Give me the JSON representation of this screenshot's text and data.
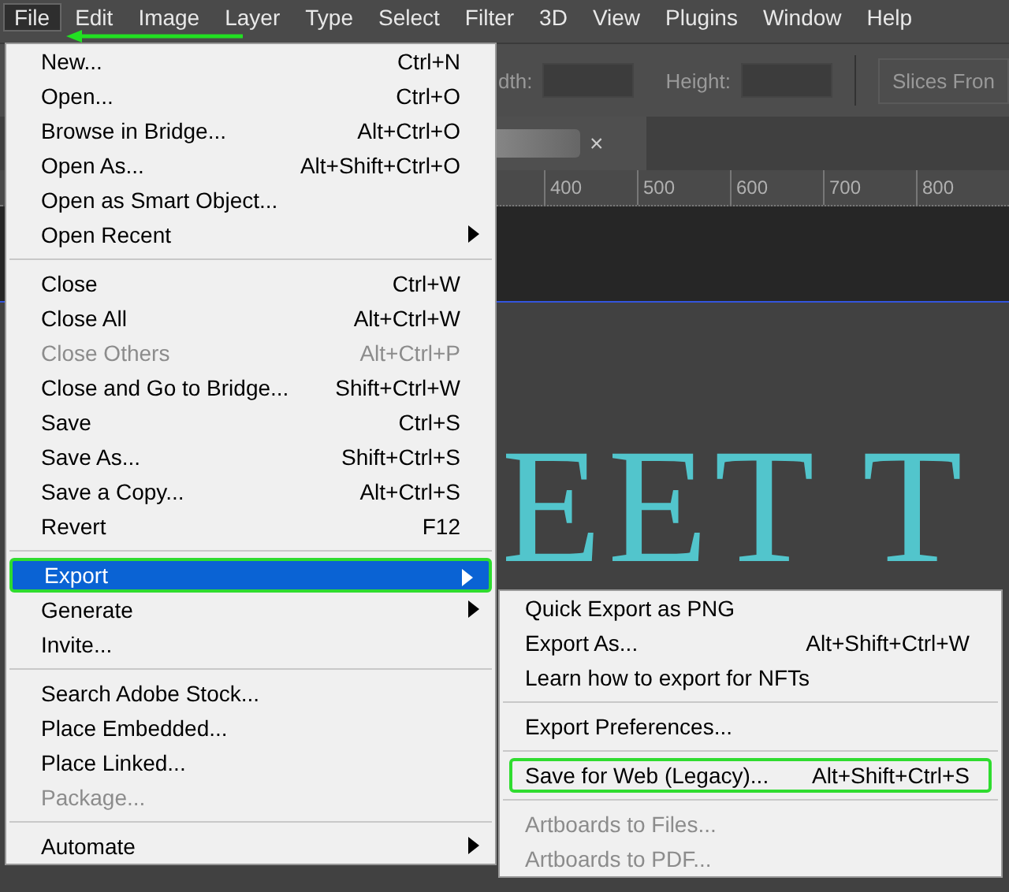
{
  "menu_bar": [
    {
      "label": "File",
      "selected": true
    },
    {
      "label": "Edit",
      "selected": false
    },
    {
      "label": "Image",
      "selected": false
    },
    {
      "label": "Layer",
      "selected": false
    },
    {
      "label": "Type",
      "selected": false
    },
    {
      "label": "Select",
      "selected": false
    },
    {
      "label": "Filter",
      "selected": false
    },
    {
      "label": "3D",
      "selected": false
    },
    {
      "label": "View",
      "selected": false
    },
    {
      "label": "Plugins",
      "selected": false
    },
    {
      "label": "Window",
      "selected": false
    },
    {
      "label": "Help",
      "selected": false
    }
  ],
  "options_bar": {
    "width_label": "dth:",
    "height_label": "Height:",
    "slices_button": "Slices Fron"
  },
  "document_tab": {
    "close": "×"
  },
  "ruler": [
    "400",
    "500",
    "600",
    "700",
    "800"
  ],
  "canvas_text": "EET T",
  "file_menu": [
    {
      "kind": "item",
      "label": "New...",
      "shortcut": "Ctrl+N",
      "disabled": false,
      "submenu": false,
      "selected": false,
      "outlined": false
    },
    {
      "kind": "item",
      "label": "Open...",
      "shortcut": "Ctrl+O",
      "disabled": false,
      "submenu": false,
      "selected": false,
      "outlined": false
    },
    {
      "kind": "item",
      "label": "Browse in Bridge...",
      "shortcut": "Alt+Ctrl+O",
      "disabled": false,
      "submenu": false,
      "selected": false,
      "outlined": false
    },
    {
      "kind": "item",
      "label": "Open As...",
      "shortcut": "Alt+Shift+Ctrl+O",
      "disabled": false,
      "submenu": false,
      "selected": false,
      "outlined": false
    },
    {
      "kind": "item",
      "label": "Open as Smart Object...",
      "disabled": false,
      "submenu": false,
      "selected": false,
      "outlined": false
    },
    {
      "kind": "item",
      "label": "Open Recent",
      "disabled": false,
      "submenu": true,
      "selected": false,
      "outlined": false
    },
    {
      "kind": "separator"
    },
    {
      "kind": "item",
      "label": "Close",
      "shortcut": "Ctrl+W",
      "disabled": false,
      "submenu": false,
      "selected": false,
      "outlined": false
    },
    {
      "kind": "item",
      "label": "Close All",
      "shortcut": "Alt+Ctrl+W",
      "disabled": false,
      "submenu": false,
      "selected": false,
      "outlined": false
    },
    {
      "kind": "item",
      "label": "Close Others",
      "shortcut": "Alt+Ctrl+P",
      "disabled": true,
      "submenu": false,
      "selected": false,
      "outlined": false
    },
    {
      "kind": "item",
      "label": "Close and Go to Bridge...",
      "shortcut": "Shift+Ctrl+W",
      "disabled": false,
      "submenu": false,
      "selected": false,
      "outlined": false
    },
    {
      "kind": "item",
      "label": "Save",
      "shortcut": "Ctrl+S",
      "disabled": false,
      "submenu": false,
      "selected": false,
      "outlined": false
    },
    {
      "kind": "item",
      "label": "Save As...",
      "shortcut": "Shift+Ctrl+S",
      "disabled": false,
      "submenu": false,
      "selected": false,
      "outlined": false
    },
    {
      "kind": "item",
      "label": "Save a Copy...",
      "shortcut": "Alt+Ctrl+S",
      "disabled": false,
      "submenu": false,
      "selected": false,
      "outlined": false
    },
    {
      "kind": "item",
      "label": "Revert",
      "shortcut": "F12",
      "disabled": false,
      "submenu": false,
      "selected": false,
      "outlined": false
    },
    {
      "kind": "separator"
    },
    {
      "kind": "item",
      "label": "Export",
      "disabled": false,
      "submenu": true,
      "selected": true,
      "outlined": true
    },
    {
      "kind": "item",
      "label": "Generate",
      "disabled": false,
      "submenu": true,
      "selected": false,
      "outlined": false
    },
    {
      "kind": "item",
      "label": "Invite...",
      "disabled": false,
      "submenu": false,
      "selected": false,
      "outlined": false
    },
    {
      "kind": "separator"
    },
    {
      "kind": "item",
      "label": "Search Adobe Stock...",
      "disabled": false,
      "submenu": false,
      "selected": false,
      "outlined": false
    },
    {
      "kind": "item",
      "label": "Place Embedded...",
      "disabled": false,
      "submenu": false,
      "selected": false,
      "outlined": false
    },
    {
      "kind": "item",
      "label": "Place Linked...",
      "disabled": false,
      "submenu": false,
      "selected": false,
      "outlined": false
    },
    {
      "kind": "item",
      "label": "Package...",
      "disabled": true,
      "submenu": false,
      "selected": false,
      "outlined": false
    },
    {
      "kind": "separator"
    },
    {
      "kind": "item",
      "label": "Automate",
      "disabled": false,
      "submenu": true,
      "selected": false,
      "outlined": false
    }
  ],
  "export_menu": [
    {
      "kind": "item",
      "label": "Quick Export as PNG",
      "disabled": false,
      "outlined": false
    },
    {
      "kind": "item",
      "label": "Export As...",
      "shortcut": "Alt+Shift+Ctrl+W",
      "disabled": false,
      "outlined": false
    },
    {
      "kind": "item",
      "label": "Learn how to export for NFTs",
      "disabled": false,
      "outlined": false
    },
    {
      "kind": "separator"
    },
    {
      "kind": "item",
      "label": "Export Preferences...",
      "disabled": false,
      "outlined": false
    },
    {
      "kind": "separator"
    },
    {
      "kind": "item",
      "label": "Save for Web (Legacy)...",
      "shortcut": "Alt+Shift+Ctrl+S",
      "disabled": false,
      "outlined": true
    },
    {
      "kind": "separator"
    },
    {
      "kind": "item",
      "label": "Artboards to Files...",
      "disabled": true,
      "outlined": false
    },
    {
      "kind": "item",
      "label": "Artboards to PDF...",
      "disabled": true,
      "outlined": false
    }
  ]
}
